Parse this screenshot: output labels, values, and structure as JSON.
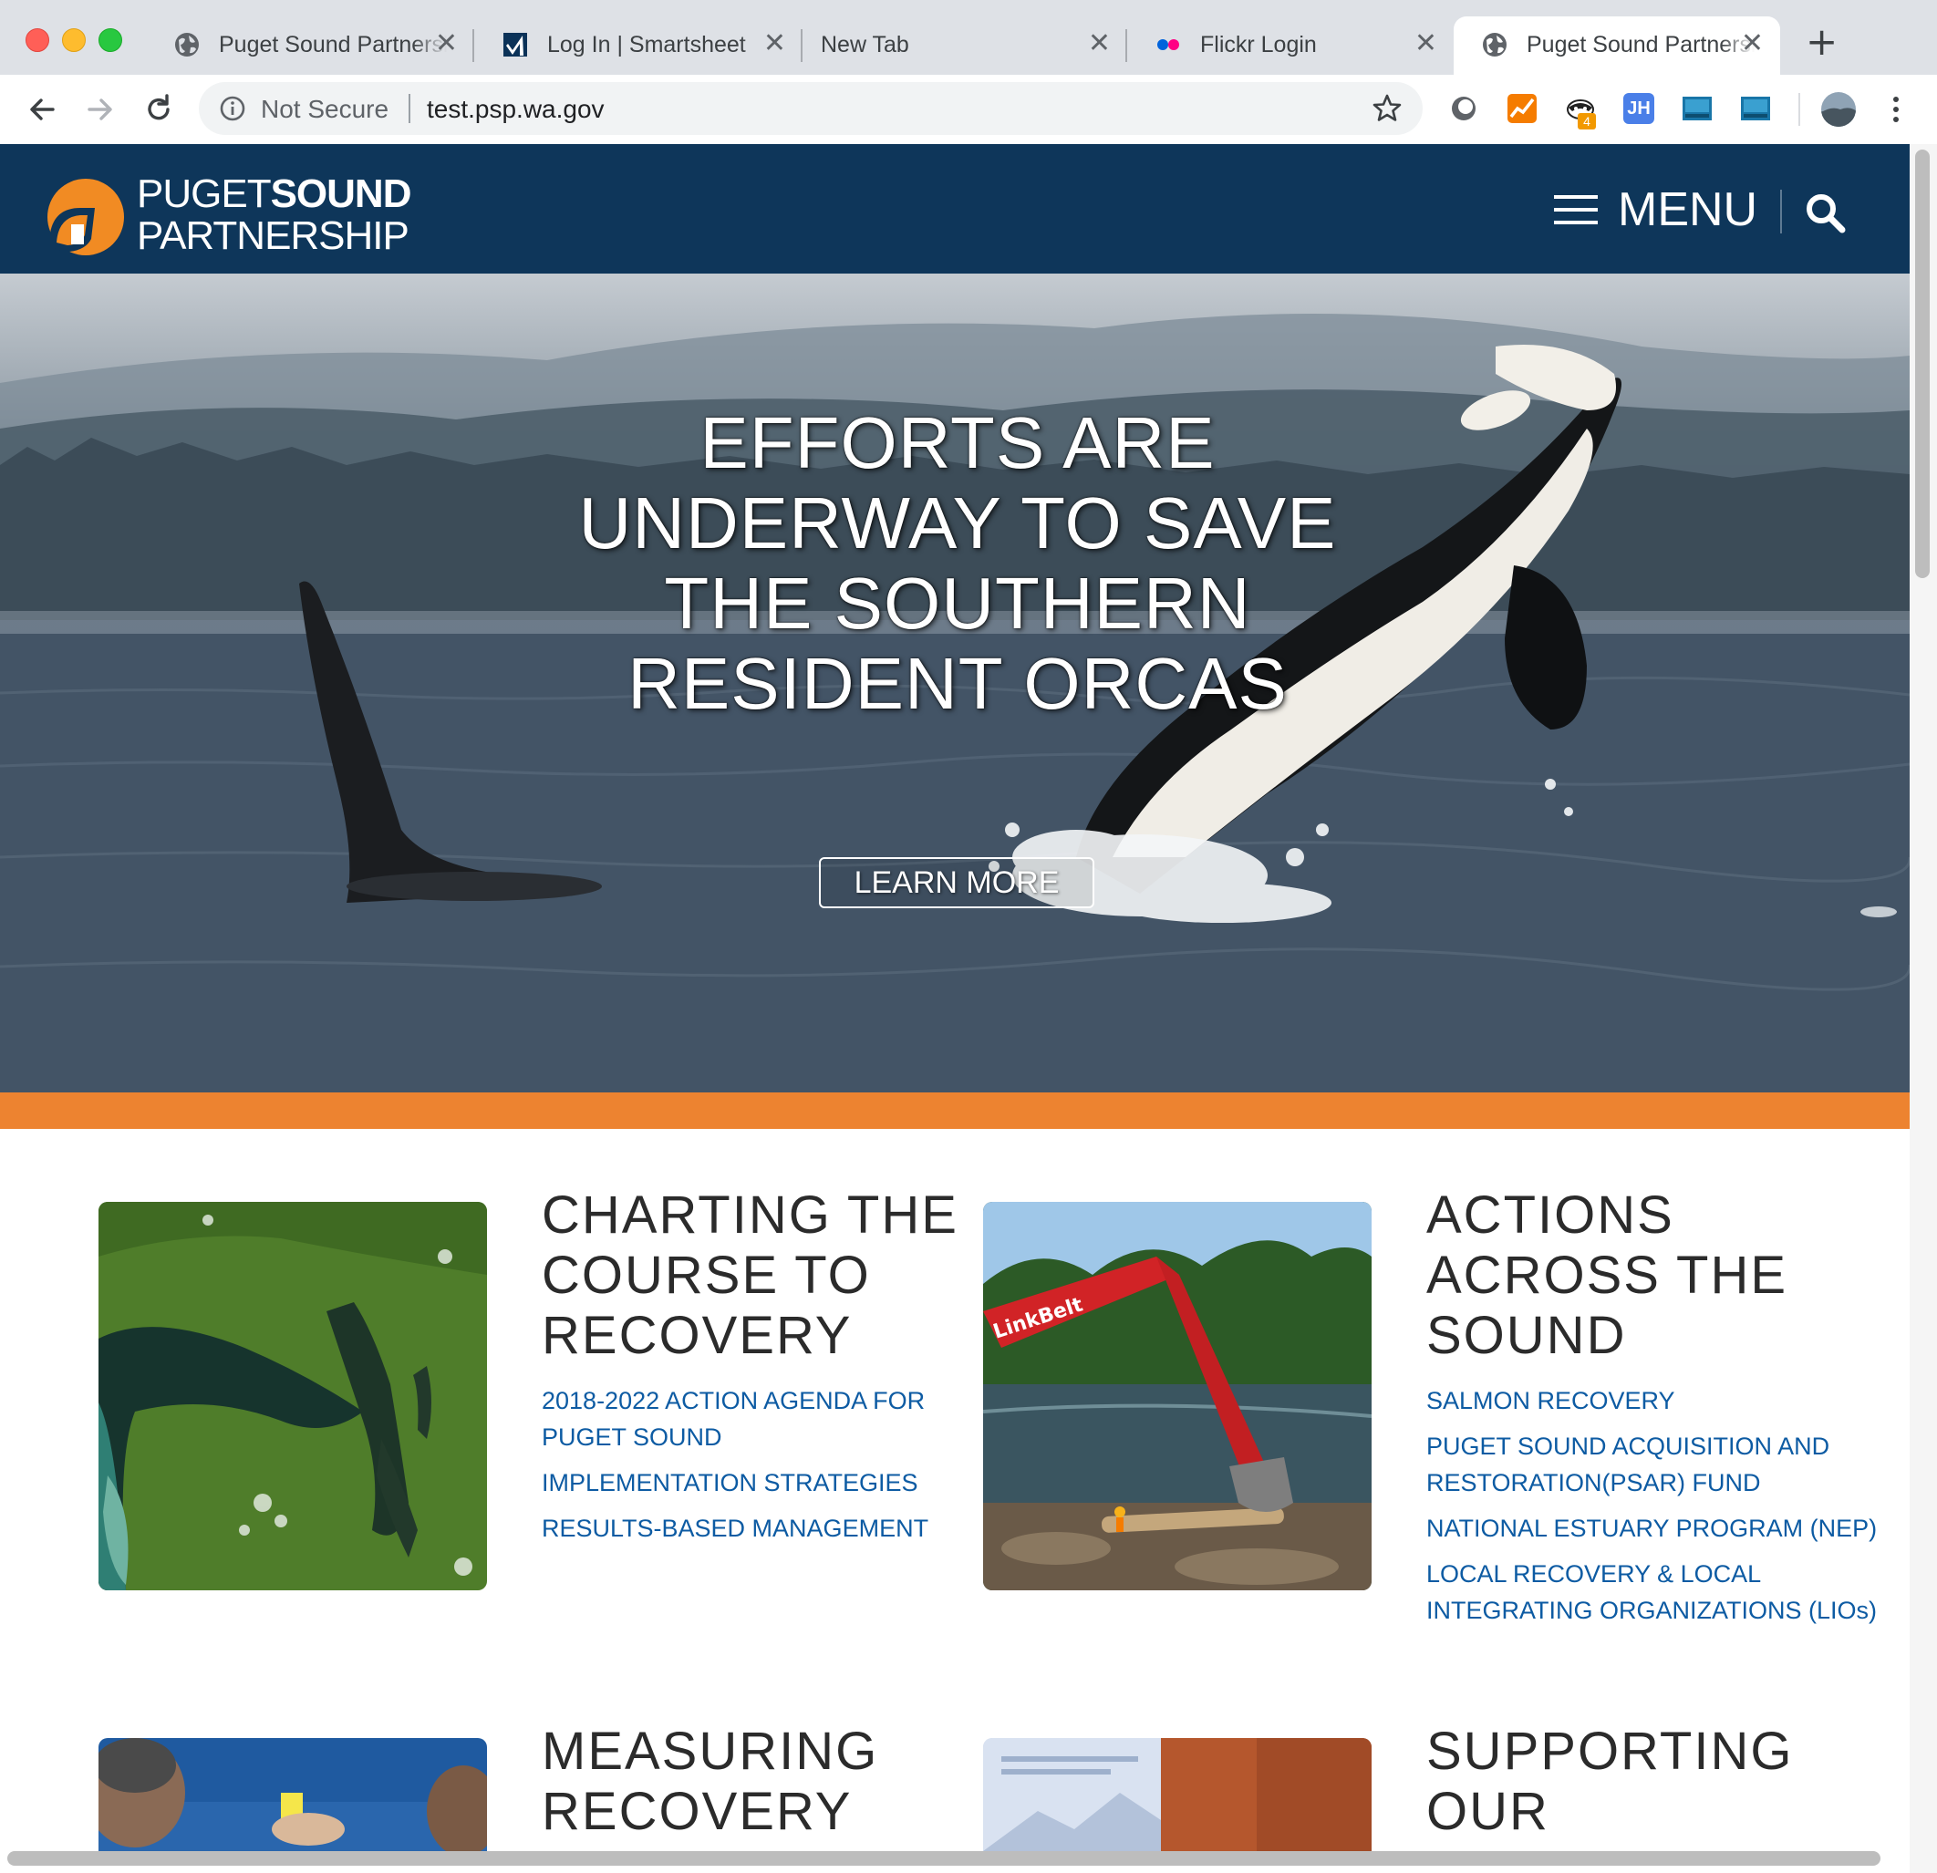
{
  "browser": {
    "tabs": [
      {
        "title": "Puget Sound Partnership",
        "icon": "globe-icon",
        "active": false
      },
      {
        "title": "Log In | Smartsheet",
        "icon": "smartsheet-icon",
        "active": false
      },
      {
        "title": "New Tab",
        "icon": "",
        "active": false
      },
      {
        "title": "Flickr Login",
        "icon": "flickr-icon",
        "active": false
      },
      {
        "title": "Puget Sound Partnership",
        "icon": "globe-icon",
        "active": true
      }
    ],
    "close_glyph": "✕",
    "new_tab_glyph": "+",
    "security_label": "Not Secure",
    "url": "test.psp.wa.gov",
    "extension_badge": "4",
    "extension_jh": "JH"
  },
  "site": {
    "logo": {
      "line1_light": "PUGET",
      "line1_bold": "SOUND",
      "line2": "PARTNERSHIP"
    },
    "menu_label": "MENU",
    "colors": {
      "navy": "#0e365a",
      "orange": "#ed8330",
      "link": "#0d5ba3"
    }
  },
  "hero": {
    "title": "EFFORTS ARE UNDERWAY TO SAVE THE SOUTHERN RESIDENT ORCAS",
    "button_label": "LEARN MORE"
  },
  "cards": [
    {
      "title": "CHARTING THE COURSE TO RECOVERY",
      "links": [
        "2018-2022 ACTION AGENDA FOR PUGET SOUND",
        "IMPLEMENTATION STRATEGIES",
        "RESULTS-BASED MANAGEMENT"
      ]
    },
    {
      "title": "ACTIONS ACROSS THE SOUND",
      "links": [
        "SALMON RECOVERY",
        "PUGET SOUND ACQUISITION AND RESTORATION(PSAR) FUND",
        "NATIONAL ESTUARY PROGRAM (NEP)",
        "LOCAL RECOVERY & LOCAL INTEGRATING ORGANIZATIONS (LIOs)"
      ]
    },
    {
      "title": "MEASURING RECOVERY",
      "links": []
    },
    {
      "title": "SUPPORTING OUR",
      "links": []
    }
  ],
  "excavator_brand": "LinkBelt"
}
